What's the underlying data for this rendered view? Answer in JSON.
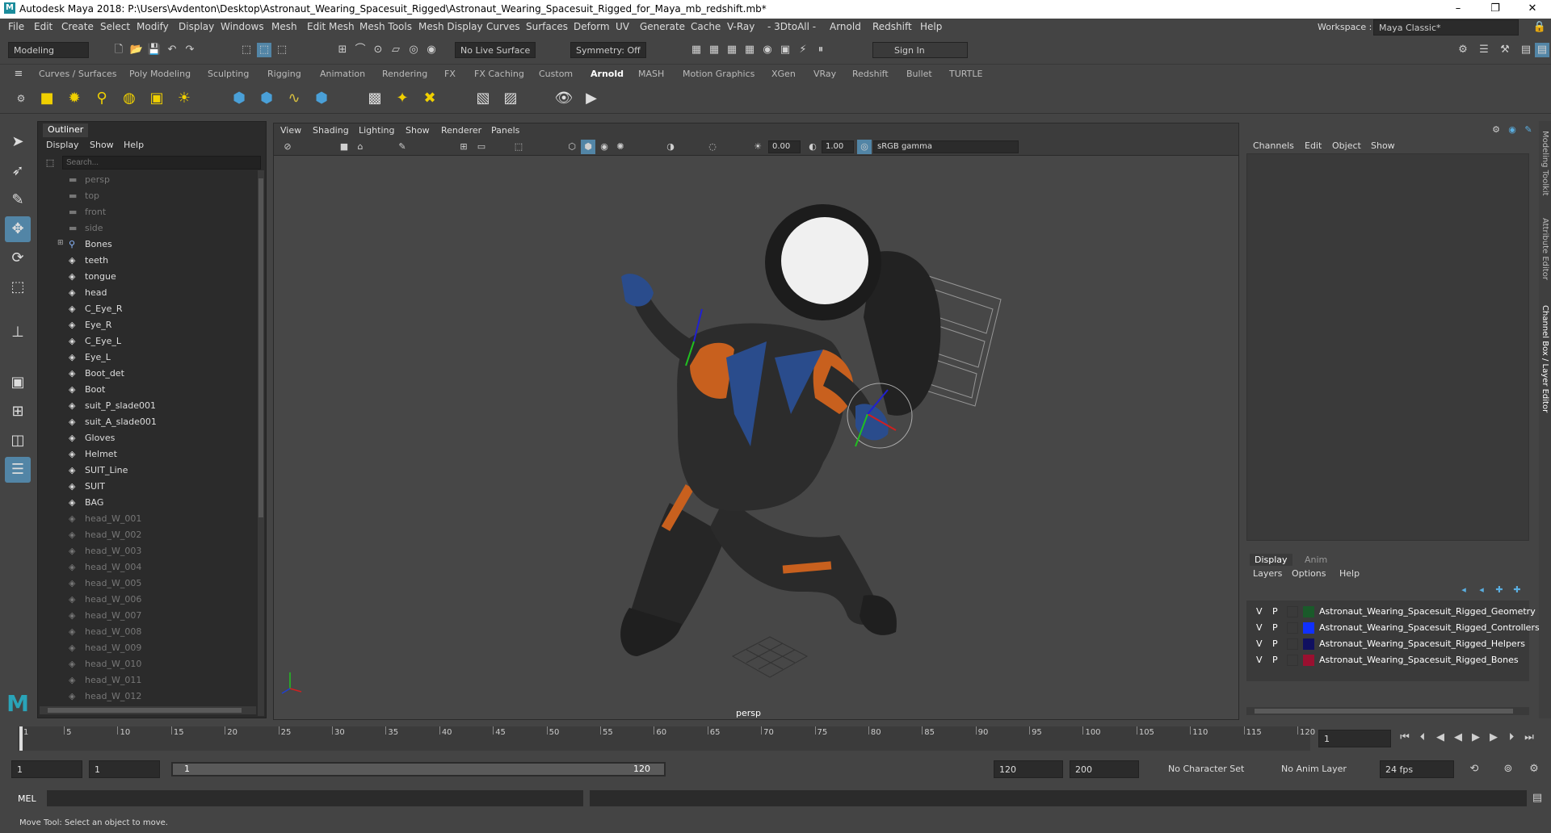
{
  "window": {
    "title": "Autodesk Maya 2018: P:\\Users\\Avdenton\\Desktop\\Astronaut_Wearing_Spacesuit_Rigged\\Astronaut_Wearing_Spacesuit_Rigged_for_Maya_mb_redshift.mb*",
    "app_icon": "M",
    "minimize": "–",
    "maximize": "❐",
    "close": "✕"
  },
  "menubar": {
    "items": [
      "File",
      "Edit",
      "Create",
      "Select",
      "Modify",
      "Display",
      "Windows",
      "Mesh",
      "Edit Mesh",
      "Mesh Tools",
      "Mesh Display",
      "Curves",
      "Surfaces",
      "Deform",
      "UV",
      "Generate",
      "Cache",
      "V-Ray",
      "- 3DtoAll -",
      "Arnold",
      "Redshift",
      "Help"
    ],
    "workspace_label": "Workspace :",
    "workspace_value": "Maya Classic*"
  },
  "statusline": {
    "mode": "Modeling",
    "live_surface": "No Live Surface",
    "symmetry": "Symmetry: Off",
    "sign_in": "Sign In"
  },
  "shelf": {
    "tabs": [
      "Curves / Surfaces",
      "Poly Modeling",
      "Sculpting",
      "Rigging",
      "Animation",
      "Rendering",
      "FX",
      "FX Caching",
      "Custom",
      "Arnold",
      "MASH",
      "Motion Graphics",
      "XGen",
      "VRay",
      "Redshift",
      "Bullet",
      "TURTLE"
    ],
    "active_tab": "Arnold"
  },
  "outliner": {
    "tab": "Outliner",
    "menus": [
      "Display",
      "Show",
      "Help"
    ],
    "search_placeholder": "Search...",
    "items": [
      {
        "label": "persp",
        "type": "camera",
        "dim": true
      },
      {
        "label": "top",
        "type": "camera",
        "dim": true
      },
      {
        "label": "front",
        "type": "camera",
        "dim": true
      },
      {
        "label": "side",
        "type": "camera",
        "dim": true
      },
      {
        "label": "Bones",
        "type": "joint",
        "dim": false,
        "expandable": true
      },
      {
        "label": "teeth",
        "type": "mesh",
        "dim": false
      },
      {
        "label": "tongue",
        "type": "mesh",
        "dim": false
      },
      {
        "label": "head",
        "type": "mesh",
        "dim": false
      },
      {
        "label": "C_Eye_R",
        "type": "mesh",
        "dim": false
      },
      {
        "label": "Eye_R",
        "type": "mesh",
        "dim": false
      },
      {
        "label": "C_Eye_L",
        "type": "mesh",
        "dim": false
      },
      {
        "label": "Eye_L",
        "type": "mesh",
        "dim": false
      },
      {
        "label": "Boot_det",
        "type": "mesh",
        "dim": false
      },
      {
        "label": "Boot",
        "type": "mesh",
        "dim": false
      },
      {
        "label": "suit_P_slade001",
        "type": "mesh",
        "dim": false
      },
      {
        "label": "suit_A_slade001",
        "type": "mesh",
        "dim": false
      },
      {
        "label": "Gloves",
        "type": "mesh",
        "dim": false
      },
      {
        "label": "Helmet",
        "type": "mesh",
        "dim": false
      },
      {
        "label": "SUIT_Line",
        "type": "mesh",
        "dim": false
      },
      {
        "label": "SUIT",
        "type": "mesh",
        "dim": false
      },
      {
        "label": "BAG",
        "type": "mesh",
        "dim": false
      },
      {
        "label": "head_W_001",
        "type": "mesh",
        "dim": true
      },
      {
        "label": "head_W_002",
        "type": "mesh",
        "dim": true
      },
      {
        "label": "head_W_003",
        "type": "mesh",
        "dim": true
      },
      {
        "label": "head_W_004",
        "type": "mesh",
        "dim": true
      },
      {
        "label": "head_W_005",
        "type": "mesh",
        "dim": true
      },
      {
        "label": "head_W_006",
        "type": "mesh",
        "dim": true
      },
      {
        "label": "head_W_007",
        "type": "mesh",
        "dim": true
      },
      {
        "label": "head_W_008",
        "type": "mesh",
        "dim": true
      },
      {
        "label": "head_W_009",
        "type": "mesh",
        "dim": true
      },
      {
        "label": "head_W_010",
        "type": "mesh",
        "dim": true
      },
      {
        "label": "head_W_011",
        "type": "mesh",
        "dim": true
      },
      {
        "label": "head_W_012",
        "type": "mesh",
        "dim": true
      }
    ]
  },
  "viewport": {
    "menus": [
      "View",
      "Shading",
      "Lighting",
      "Show",
      "Renderer",
      "Panels"
    ],
    "exposure": "0.00",
    "gamma": "1.00",
    "color_space": "sRGB gamma",
    "camera_label": "persp",
    "colors": {
      "suit": "#2a2a2a",
      "orange": "#c8601e",
      "blue": "#2a4c8c",
      "helmet": "#f0f0f0"
    }
  },
  "channelbox": {
    "menus": [
      "Channels",
      "Edit",
      "Object",
      "Show"
    ],
    "tabs": [
      "Display",
      "Anim"
    ],
    "layer_menus": [
      "Layers",
      "Options",
      "Help"
    ],
    "layers": [
      {
        "v": "V",
        "p": "P",
        "name": "Astronaut_Wearing_Spacesuit_Rigged_Geometry",
        "color": "#1a5a2a"
      },
      {
        "v": "V",
        "p": "P",
        "name": "Astronaut_Wearing_Spacesuit_Rigged_Controllers",
        "color": "#1030ff"
      },
      {
        "v": "V",
        "p": "P",
        "name": "Astronaut_Wearing_Spacesuit_Rigged_Helpers",
        "color": "#101060"
      },
      {
        "v": "V",
        "p": "P",
        "name": "Astronaut_Wearing_Spacesuit_Rigged_Bones",
        "color": "#9a1030"
      }
    ],
    "side_tabs": [
      "Modeling Toolkit",
      "Attribute Editor",
      "Channel Box / Layer Editor"
    ]
  },
  "timeslider": {
    "ticks": [
      "1",
      "5",
      "10",
      "15",
      "20",
      "25",
      "30",
      "35",
      "40",
      "45",
      "50",
      "55",
      "60",
      "65",
      "70",
      "75",
      "80",
      "85",
      "90",
      "95",
      "100",
      "105",
      "110",
      "115",
      "120"
    ],
    "current_frame": "1"
  },
  "range": {
    "start": "1",
    "anim_start": "1",
    "range_start": "1",
    "range_end": "120",
    "end": "120",
    "anim_end": "200",
    "character_set": "No Character Set",
    "anim_layer": "No Anim Layer",
    "fps": "24 fps"
  },
  "cmdline": {
    "label": "MEL"
  },
  "helpline": {
    "text": "Move Tool: Select an object to move."
  }
}
